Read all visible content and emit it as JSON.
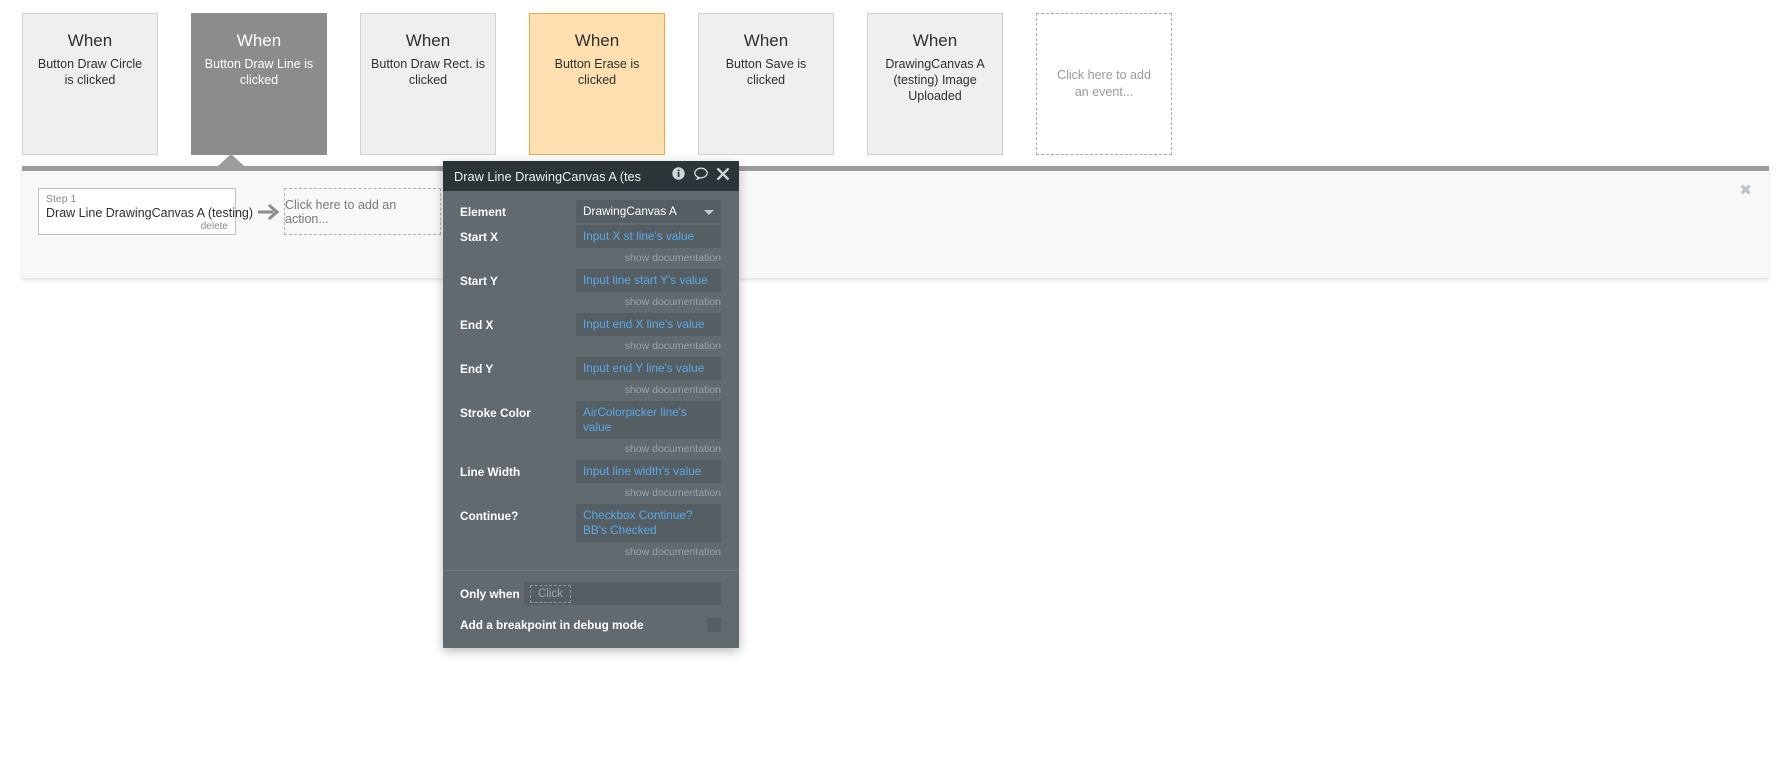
{
  "events": [
    {
      "when": "When",
      "desc": "Button Draw Circle is clicked",
      "state": "normal"
    },
    {
      "when": "When",
      "desc": "Button Draw Line is clicked",
      "state": "selected"
    },
    {
      "when": "When",
      "desc": "Button Draw Rect. is clicked",
      "state": "normal"
    },
    {
      "when": "When",
      "desc": "Button Erase is clicked",
      "state": "highlight"
    },
    {
      "when": "When",
      "desc": "Button Save is clicked",
      "state": "normal"
    },
    {
      "when": "When",
      "desc": "DrawingCanvas A (testing) Image Uploaded",
      "state": "normal"
    }
  ],
  "add_event": {
    "label": "Click here to add an event..."
  },
  "action_panel": {
    "close_icon": "✖",
    "step": {
      "label": "Step 1",
      "title": "Draw Line DrawingCanvas A (testing)",
      "delete_label": "delete"
    },
    "add_action_label": "Click here to add an action..."
  },
  "dialog": {
    "title": "Draw Line DrawingCanvas A (tes",
    "icons": {
      "info": "info-icon",
      "comment": "comment-icon",
      "close": "close-icon"
    },
    "doc_link_label": "show documentation",
    "fields": [
      {
        "label": "Element",
        "value": "DrawingCanvas A",
        "type": "select",
        "doc": false
      },
      {
        "label": "Start X",
        "value": "Input X st line's value",
        "type": "expr",
        "doc": true
      },
      {
        "label": "Start Y",
        "value": "Input line start Y's value",
        "type": "expr",
        "doc": true
      },
      {
        "label": "End X",
        "value": "Input end X line's value",
        "type": "expr",
        "doc": true
      },
      {
        "label": "End Y",
        "value": "Input end Y line's value",
        "type": "expr",
        "doc": true
      },
      {
        "label": "Stroke Color",
        "value": "AirColorpicker line's value",
        "type": "expr",
        "doc": true
      },
      {
        "label": "Line Width",
        "value": "Input line width's value",
        "type": "expr",
        "doc": true
      },
      {
        "label": "Continue?",
        "value": "Checkbox Continue? BB's Checked",
        "type": "expr",
        "doc": true
      }
    ],
    "only_when": {
      "label": "Only when",
      "placeholder": "Click"
    },
    "breakpoint": {
      "label": "Add a breakpoint in debug mode"
    }
  },
  "colors": {
    "selected_event": "#8c8c8c",
    "highlight_event": "#ffdfb0",
    "highlight_border": "#f0a847",
    "dialog_header": "#2b3437",
    "dialog_body": "#616a6e",
    "expression_text": "#5aa8e8"
  }
}
